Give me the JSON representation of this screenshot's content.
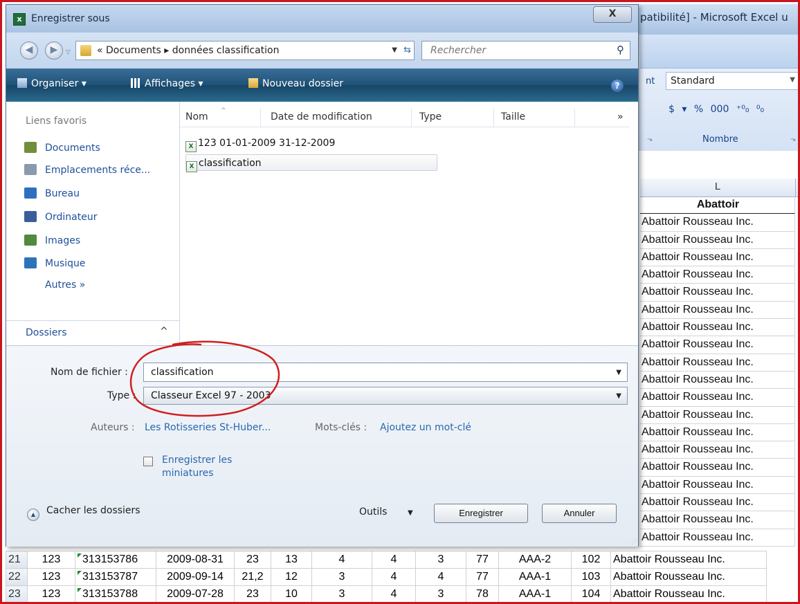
{
  "excel": {
    "title_fragment": "patibilité] - Microsoft Excel u",
    "ribbon_font_fragment": "nt",
    "number_format": "Standard",
    "number_buttons": [
      "$",
      "▾",
      "%",
      "000",
      "⁺⁰₀",
      "⁰₀"
    ],
    "group_label": "Nombre",
    "column_header": "L",
    "column_title": "Abattoir",
    "abattoir_value": "Abattoir Rousseau Inc.",
    "visible_rows": [
      {
        "row": "21",
        "a": "123",
        "b": "313153786",
        "c": "2009-08-31",
        "d": "23",
        "e": "13",
        "f": "4",
        "g": "4",
        "h": "3",
        "i": "77",
        "j": "AAA-2",
        "k": "102",
        "l": "Abattoir Rousseau Inc."
      },
      {
        "row": "22",
        "a": "123",
        "b": "313153787",
        "c": "2009-09-14",
        "d": "21,2",
        "e": "12",
        "f": "3",
        "g": "4",
        "h": "4",
        "i": "77",
        "j": "AAA-1",
        "k": "103",
        "l": "Abattoir Rousseau Inc."
      },
      {
        "row": "23",
        "a": "123",
        "b": "313153788",
        "c": "2009-07-28",
        "d": "23",
        "e": "10",
        "f": "3",
        "g": "4",
        "h": "3",
        "i": "78",
        "j": "AAA-1",
        "k": "104",
        "l": "Abattoir Rousseau Inc."
      }
    ]
  },
  "dialog": {
    "title": "Enregistrer sous",
    "close_label": "X",
    "breadcrumb": "« Documents ▸ données classification",
    "search_placeholder": "Rechercher",
    "commands": {
      "organize": "Organiser ▾",
      "views": "Affichages ▾",
      "new_folder": "Nouveau dossier",
      "help": "?"
    },
    "nav": {
      "header": "Liens favoris",
      "items": [
        {
          "label": "Documents",
          "color": "#6f8f3a"
        },
        {
          "label": "Emplacements réce...",
          "color": "#8a9aae"
        },
        {
          "label": "Bureau",
          "color": "#2f6fc0"
        },
        {
          "label": "Ordinateur",
          "color": "#3a5e9a"
        },
        {
          "label": "Images",
          "color": "#4f8a3e"
        },
        {
          "label": "Musique",
          "color": "#2c73b8"
        }
      ],
      "more": "Autres »",
      "folders": "Dossiers",
      "folders_chevron": "^"
    },
    "columns": {
      "name": "Nom",
      "date": "Date de modification",
      "type": "Type",
      "size": "Taille",
      "more": "»"
    },
    "files": [
      {
        "name": "123  01-01-2009  31-12-2009"
      },
      {
        "name": "classification"
      }
    ],
    "filename_label": "Nom de fichier :",
    "filename_value": "classification",
    "type_label": "Type :",
    "type_value": "Classeur Excel 97 - 2003",
    "authors_label": "Auteurs :",
    "authors_value": "Les Rotisseries St-Huber...",
    "keywords_label": "Mots-clés :",
    "keywords_value": "Ajoutez un mot-clé",
    "thumbnails_label": "Enregistrer les miniatures",
    "hide_folders": "Cacher les dossiers",
    "tools": "Outils",
    "save": "Enregistrer",
    "cancel": "Annuler"
  }
}
